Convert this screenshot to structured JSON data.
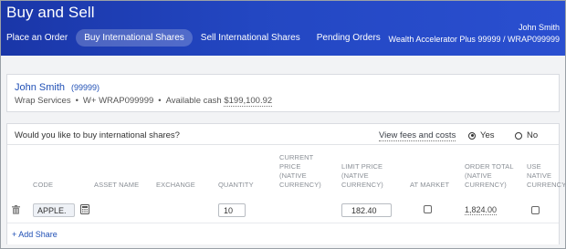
{
  "header": {
    "title": "Buy and Sell",
    "tabs": [
      {
        "label": "Place an Order",
        "active": false
      },
      {
        "label": "Buy International Shares",
        "active": true
      },
      {
        "label": "Sell International Shares",
        "active": false
      },
      {
        "label": "Pending Orders",
        "active": false
      }
    ],
    "user_name": "John Smith",
    "account_line": "Wealth Accelerator Plus 99999 / WRAP099999"
  },
  "client": {
    "name": "John Smith",
    "id": "(99999)",
    "service": "Wrap Services",
    "account": "W+ WRAP099999",
    "cash_label": "Available cash",
    "cash_value": "$199,100.92"
  },
  "question": {
    "text": "Would you like to buy international shares?",
    "fees_link": "View fees and costs",
    "yes_label": "Yes",
    "no_label": "No",
    "selected": "Yes"
  },
  "table": {
    "headers": {
      "code": "CODE",
      "asset_name": "ASSET NAME",
      "exchange": "EXCHANGE",
      "quantity": "QUANTITY",
      "current_price": [
        "CURRENT",
        "PRICE",
        "(NATIVE",
        "CURRENCY)"
      ],
      "limit_price": [
        "LIMIT PRICE",
        "(NATIVE",
        "CURRENCY)"
      ],
      "at_market": "AT MARKET",
      "order_total": [
        "ORDER TOTAL",
        "(NATIVE",
        "CURRENCY)"
      ],
      "use_native": [
        "USE",
        "NATIVE",
        "CURRENCY"
      ]
    },
    "row": {
      "code": "APPLE.",
      "quantity": "10",
      "limit_price": "182.40",
      "at_market": false,
      "order_total": "1,824.00",
      "use_native": false
    },
    "add_share": "+ Add Share"
  },
  "icons": {
    "trash": "trash-icon",
    "calculator": "calculator-icon"
  },
  "colors": {
    "header_start": "#1a36a8",
    "header_end": "#2a4fd0",
    "link": "#1f4fb5"
  }
}
